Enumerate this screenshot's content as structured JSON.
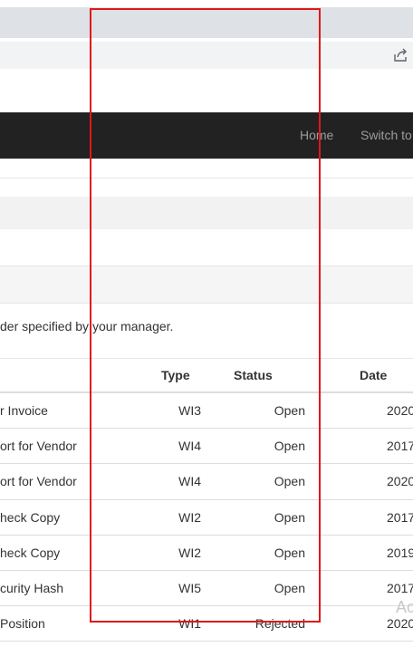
{
  "navbar": {
    "home_label": "Home",
    "switch_label": "Switch to"
  },
  "instruction_text": "der specified by your manager.",
  "table": {
    "headers": {
      "type": "Type",
      "status": "Status",
      "date": "Date"
    },
    "rows": [
      {
        "title": "r Invoice",
        "type": "WI3",
        "status": "Open",
        "date": "2020"
      },
      {
        "title": "ort for Vendor",
        "type": "WI4",
        "status": "Open",
        "date": "2017"
      },
      {
        "title": "ort for Vendor",
        "type": "WI4",
        "status": "Open",
        "date": "2020"
      },
      {
        "title": "heck Copy",
        "type": "WI2",
        "status": "Open",
        "date": "2017"
      },
      {
        "title": "heck Copy",
        "type": "WI2",
        "status": "Open",
        "date": "2019"
      },
      {
        "title": "curity Hash",
        "type": "WI5",
        "status": "Open",
        "date": "2017"
      },
      {
        "title": "Position",
        "type": "WI1",
        "status": "Rejected",
        "date": "2020"
      }
    ]
  },
  "watermark_text": "Ac",
  "colors": {
    "navbar_bg": "#222222",
    "highlight_border": "#e01818"
  },
  "icons": {
    "share": "share-icon"
  }
}
